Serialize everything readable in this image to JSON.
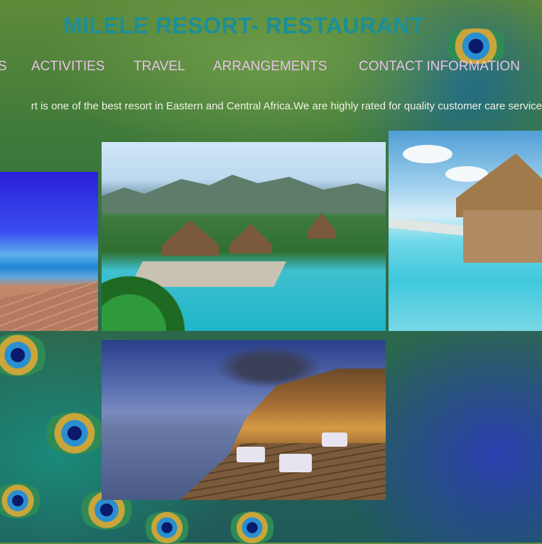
{
  "site": {
    "title": "MILELE RESORT- RESTAURANT"
  },
  "nav": {
    "items": [
      {
        "label": "S"
      },
      {
        "label": "ACTIVITIES"
      },
      {
        "label": "TRAVEL"
      },
      {
        "label": "ARRANGEMENTS"
      },
      {
        "label": "CONTACT INFORMATION"
      }
    ]
  },
  "intro": {
    "text": "rt is one of the best resort in Eastern and Central Africa.We are highly rated for quality customer care service"
  },
  "colors": {
    "title": "#1b8f9a",
    "nav_text": "#e7c2e6",
    "tagline_text": "#f1f1e4"
  },
  "gallery": [
    {
      "name": "ocean-deck-photo"
    },
    {
      "name": "pool-resort-photo"
    },
    {
      "name": "overwater-bungalow-photo"
    },
    {
      "name": "evening-deck-restaurant-photo"
    }
  ]
}
